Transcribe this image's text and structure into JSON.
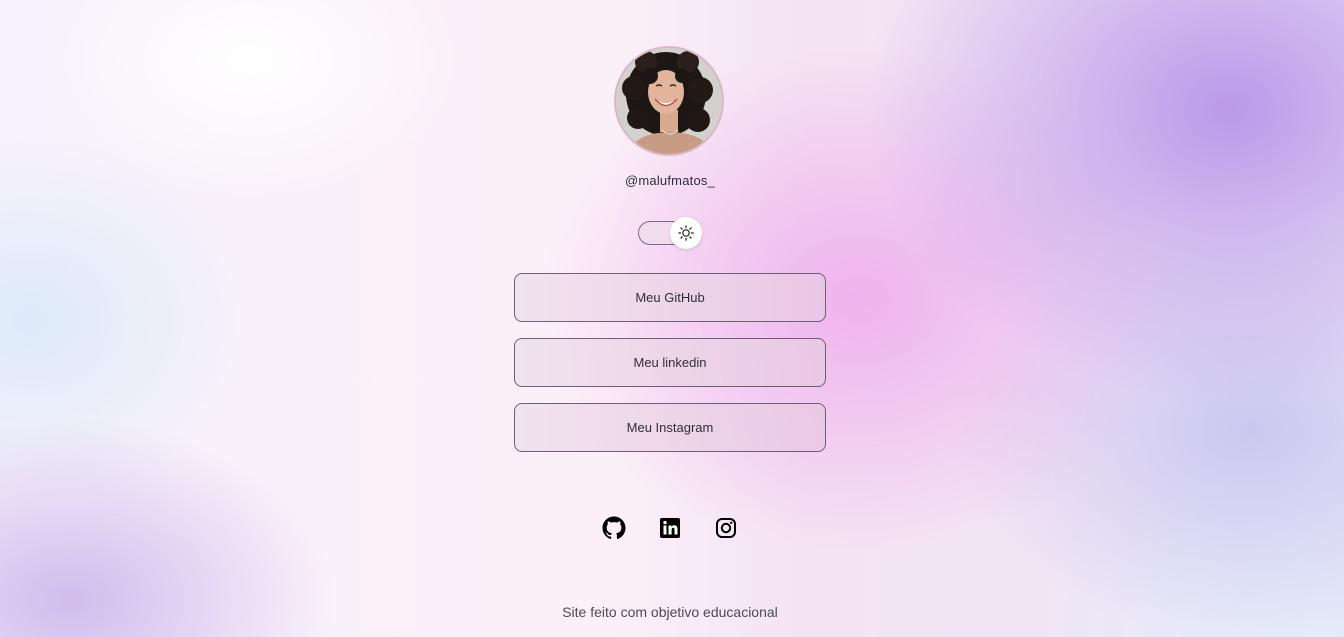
{
  "profile": {
    "avatar_alt": "Foto de perfil",
    "handle": "@malufmatos_"
  },
  "theme_toggle": {
    "icon": "sun-icon",
    "state": "light"
  },
  "links": [
    {
      "label": "Meu GitHub"
    },
    {
      "label": "Meu linkedin"
    },
    {
      "label": "Meu Instagram"
    }
  ],
  "social_icons": [
    "github-icon",
    "linkedin-icon",
    "instagram-icon"
  ],
  "footer": {
    "text": "Site feito com objetivo educacional"
  },
  "colors": {
    "button_border": "#6f5e75",
    "text": "#2f2f3a",
    "accent_purple": "#b08ce8",
    "accent_pink": "#eeaaec"
  }
}
